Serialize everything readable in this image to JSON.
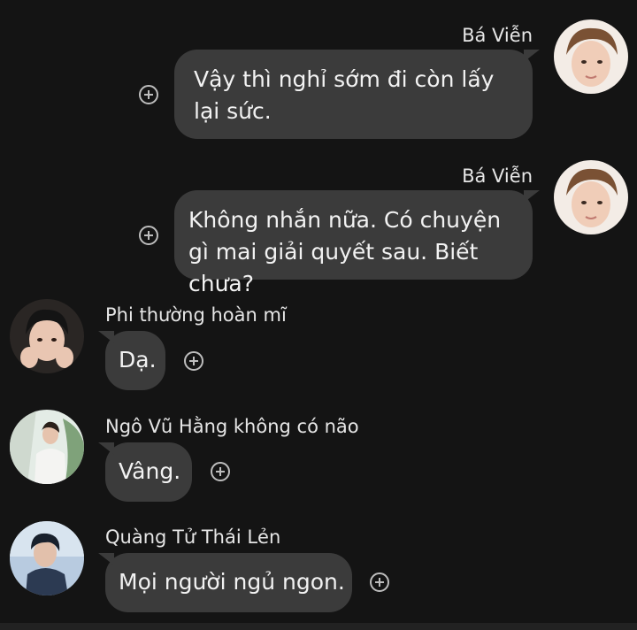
{
  "messages": [
    {
      "sender": "Bá Viễn",
      "text": "Vậy thì nghỉ sớm đi còn lấy lại sức."
    },
    {
      "sender": "Bá Viễn",
      "text": "Không nhắn nữa. Có chuyện gì mai giải quyết sau. Biết chưa?"
    },
    {
      "sender": "Phi thường hoàn mĩ",
      "text": "Dạ."
    },
    {
      "sender": "Ngô Vũ Hằng không có não",
      "text": "Vâng."
    },
    {
      "sender": "Quàng Tử Thái Lẻn",
      "text": "Mọi người ngủ ngon."
    }
  ],
  "icons": {
    "react": "add-reaction-icon",
    "avatar": "avatar"
  },
  "colors": {
    "background": "#141414",
    "bubble": "#3b3b3b",
    "text": "#f2f2f2"
  }
}
